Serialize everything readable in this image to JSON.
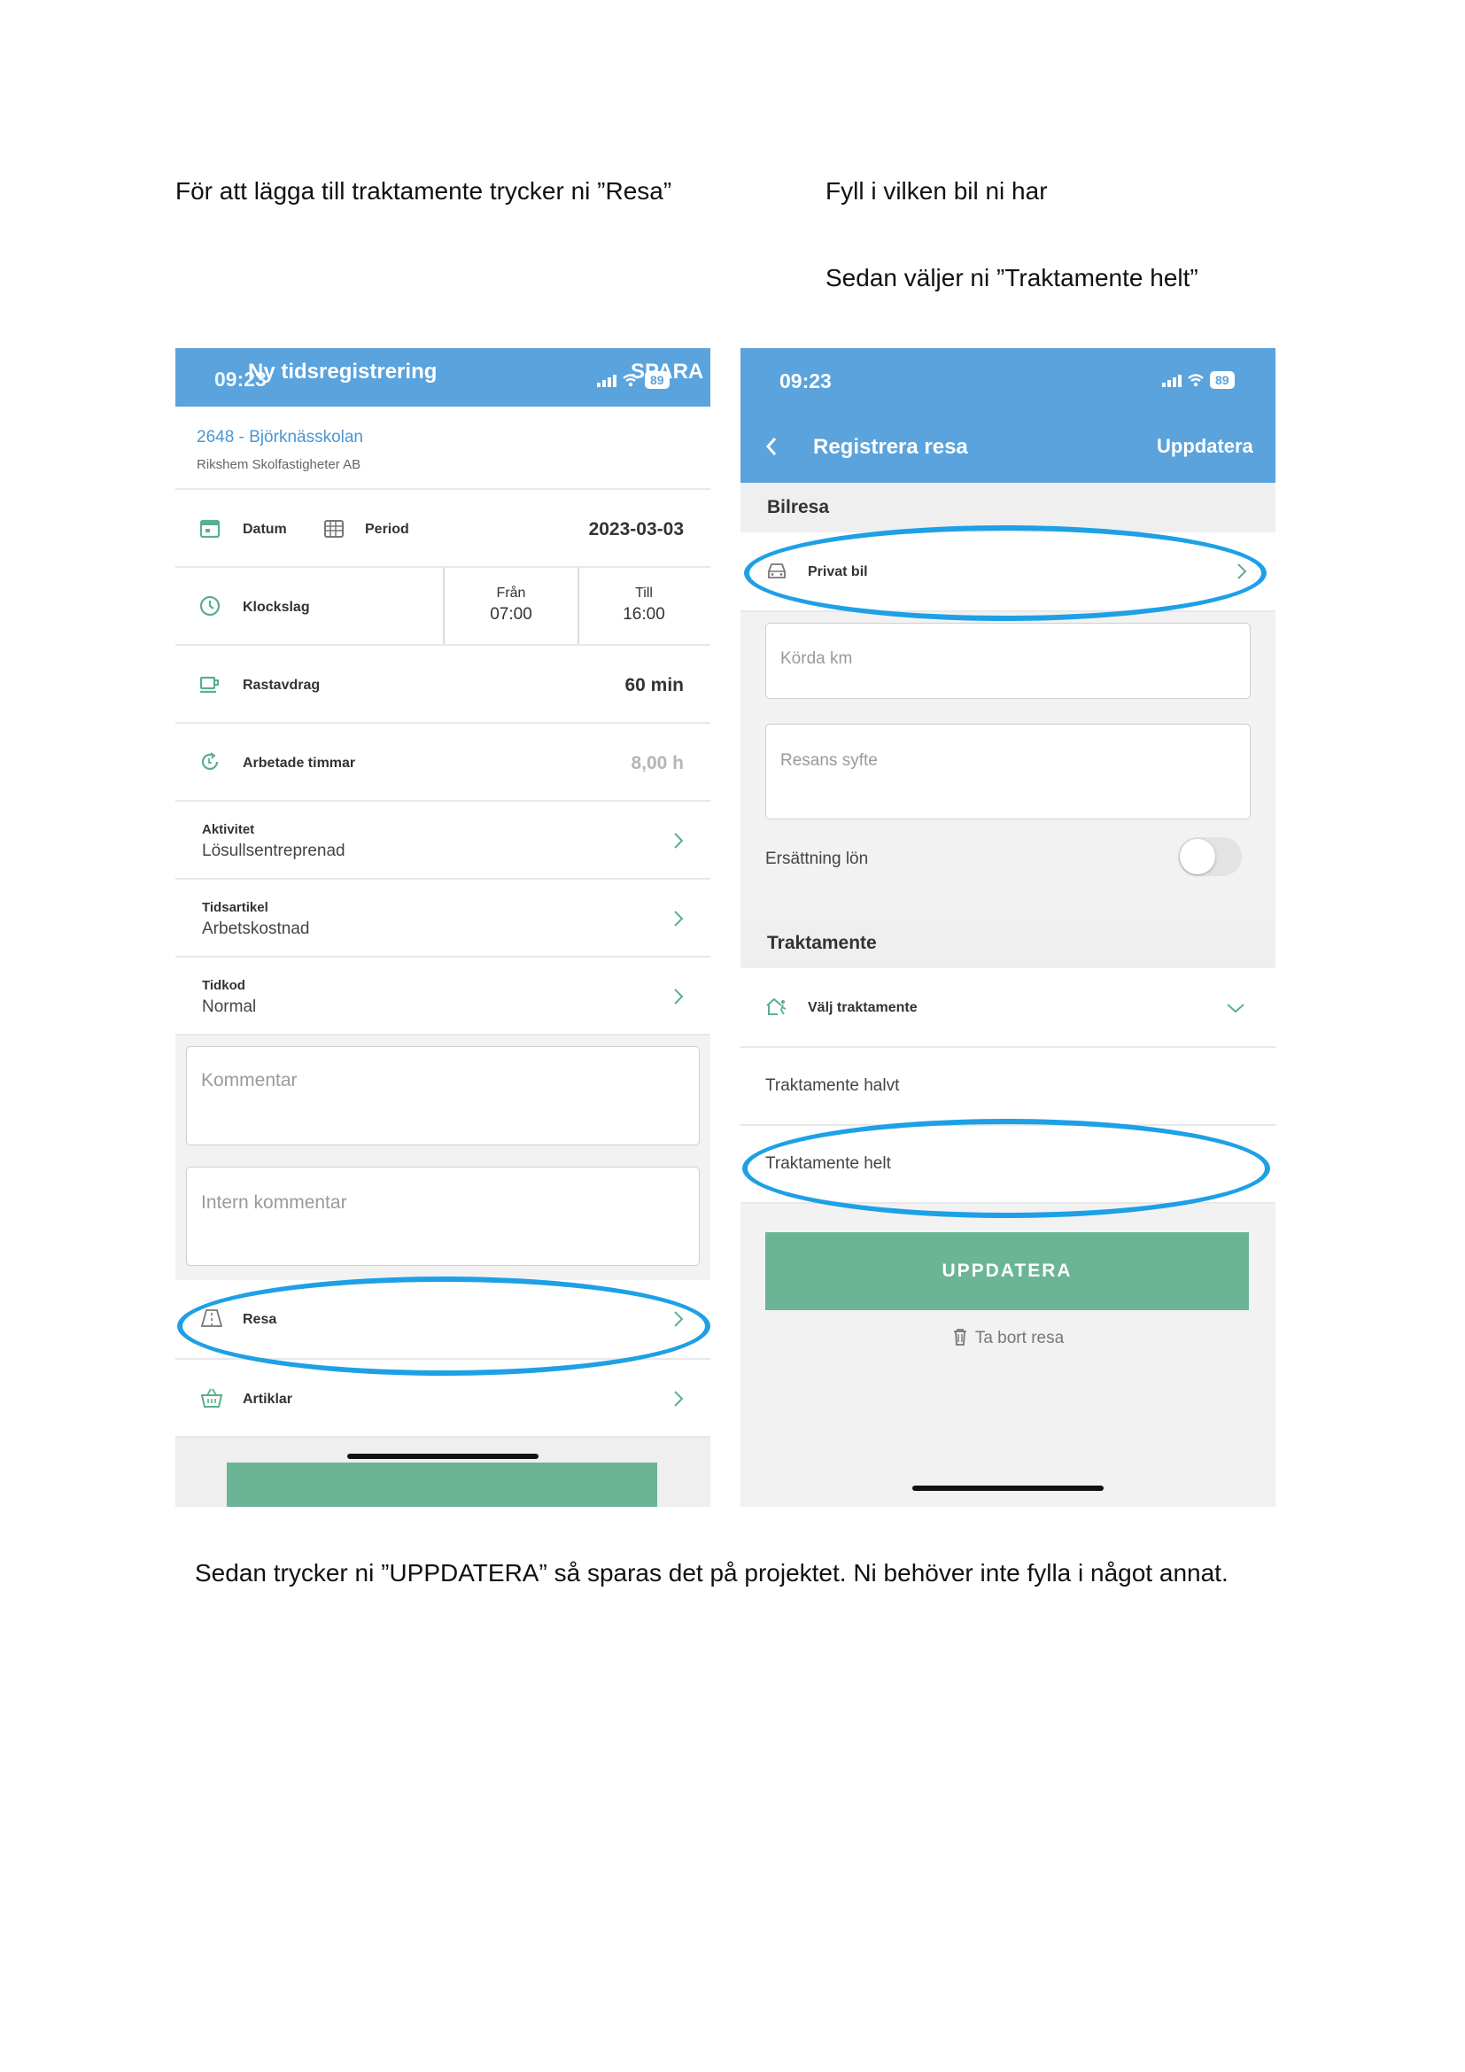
{
  "captions": {
    "left": "För att lägga till traktamente trycker ni ”Resa”",
    "right1": "Fyll i vilken bil ni har",
    "right2": "Sedan väljer ni ”Traktamente helt”",
    "bottom": "Sedan trycker ni ”UPPDATERA” så sparas det på projektet. Ni behöver inte fylla i något annat."
  },
  "phone1": {
    "time": "09:23",
    "title": "Ny tidsregistrering",
    "action": "SPARA",
    "battery": "89",
    "project_link": "2648 - Björknässkolan",
    "customer": "Rikshem Skolfastigheter AB",
    "datum_label": "Datum",
    "period_label": "Period",
    "date_value": "2023-03-03",
    "klockslag_label": "Klockslag",
    "fran_label": "Från",
    "fran_value": "07:00",
    "till_label": "Till",
    "till_value": "16:00",
    "rast_label": "Rastavdrag",
    "rast_value": "60 min",
    "arbetade_label": "Arbetade timmar",
    "arbetade_value": "8,00 h",
    "aktivitet_label": "Aktivitet",
    "aktivitet_value": "Lösullsentreprenad",
    "tidsartikel_label": "Tidsartikel",
    "tidsartikel_value": "Arbetskostnad",
    "tidkod_label": "Tidkod",
    "tidkod_value": "Normal",
    "kommentar_placeholder": "Kommentar",
    "intern_placeholder": "Intern kommentar",
    "resa_label": "Resa",
    "artiklar_label": "Artiklar"
  },
  "phone2": {
    "time": "09:23",
    "battery": "89",
    "title": "Registrera resa",
    "action": "Uppdatera",
    "bilresa_section": "Bilresa",
    "privat_bil": "Privat bil",
    "korda_km_placeholder": "Körda km",
    "syfte_placeholder": "Resans syfte",
    "ersattning_label": "Ersättning lön",
    "ersattning_on": false,
    "traktamente_section": "Traktamente",
    "valj_traktamente": "Välj traktamente",
    "halvt": "Traktamente halvt",
    "helt": "Traktamente helt",
    "update_button": "UPPDATERA",
    "delete_label": "Ta bort resa"
  },
  "colors": {
    "header_blue": "#5aa3dc",
    "accent_green": "#6bb596",
    "highlight_oval": "#1ea0e6"
  }
}
